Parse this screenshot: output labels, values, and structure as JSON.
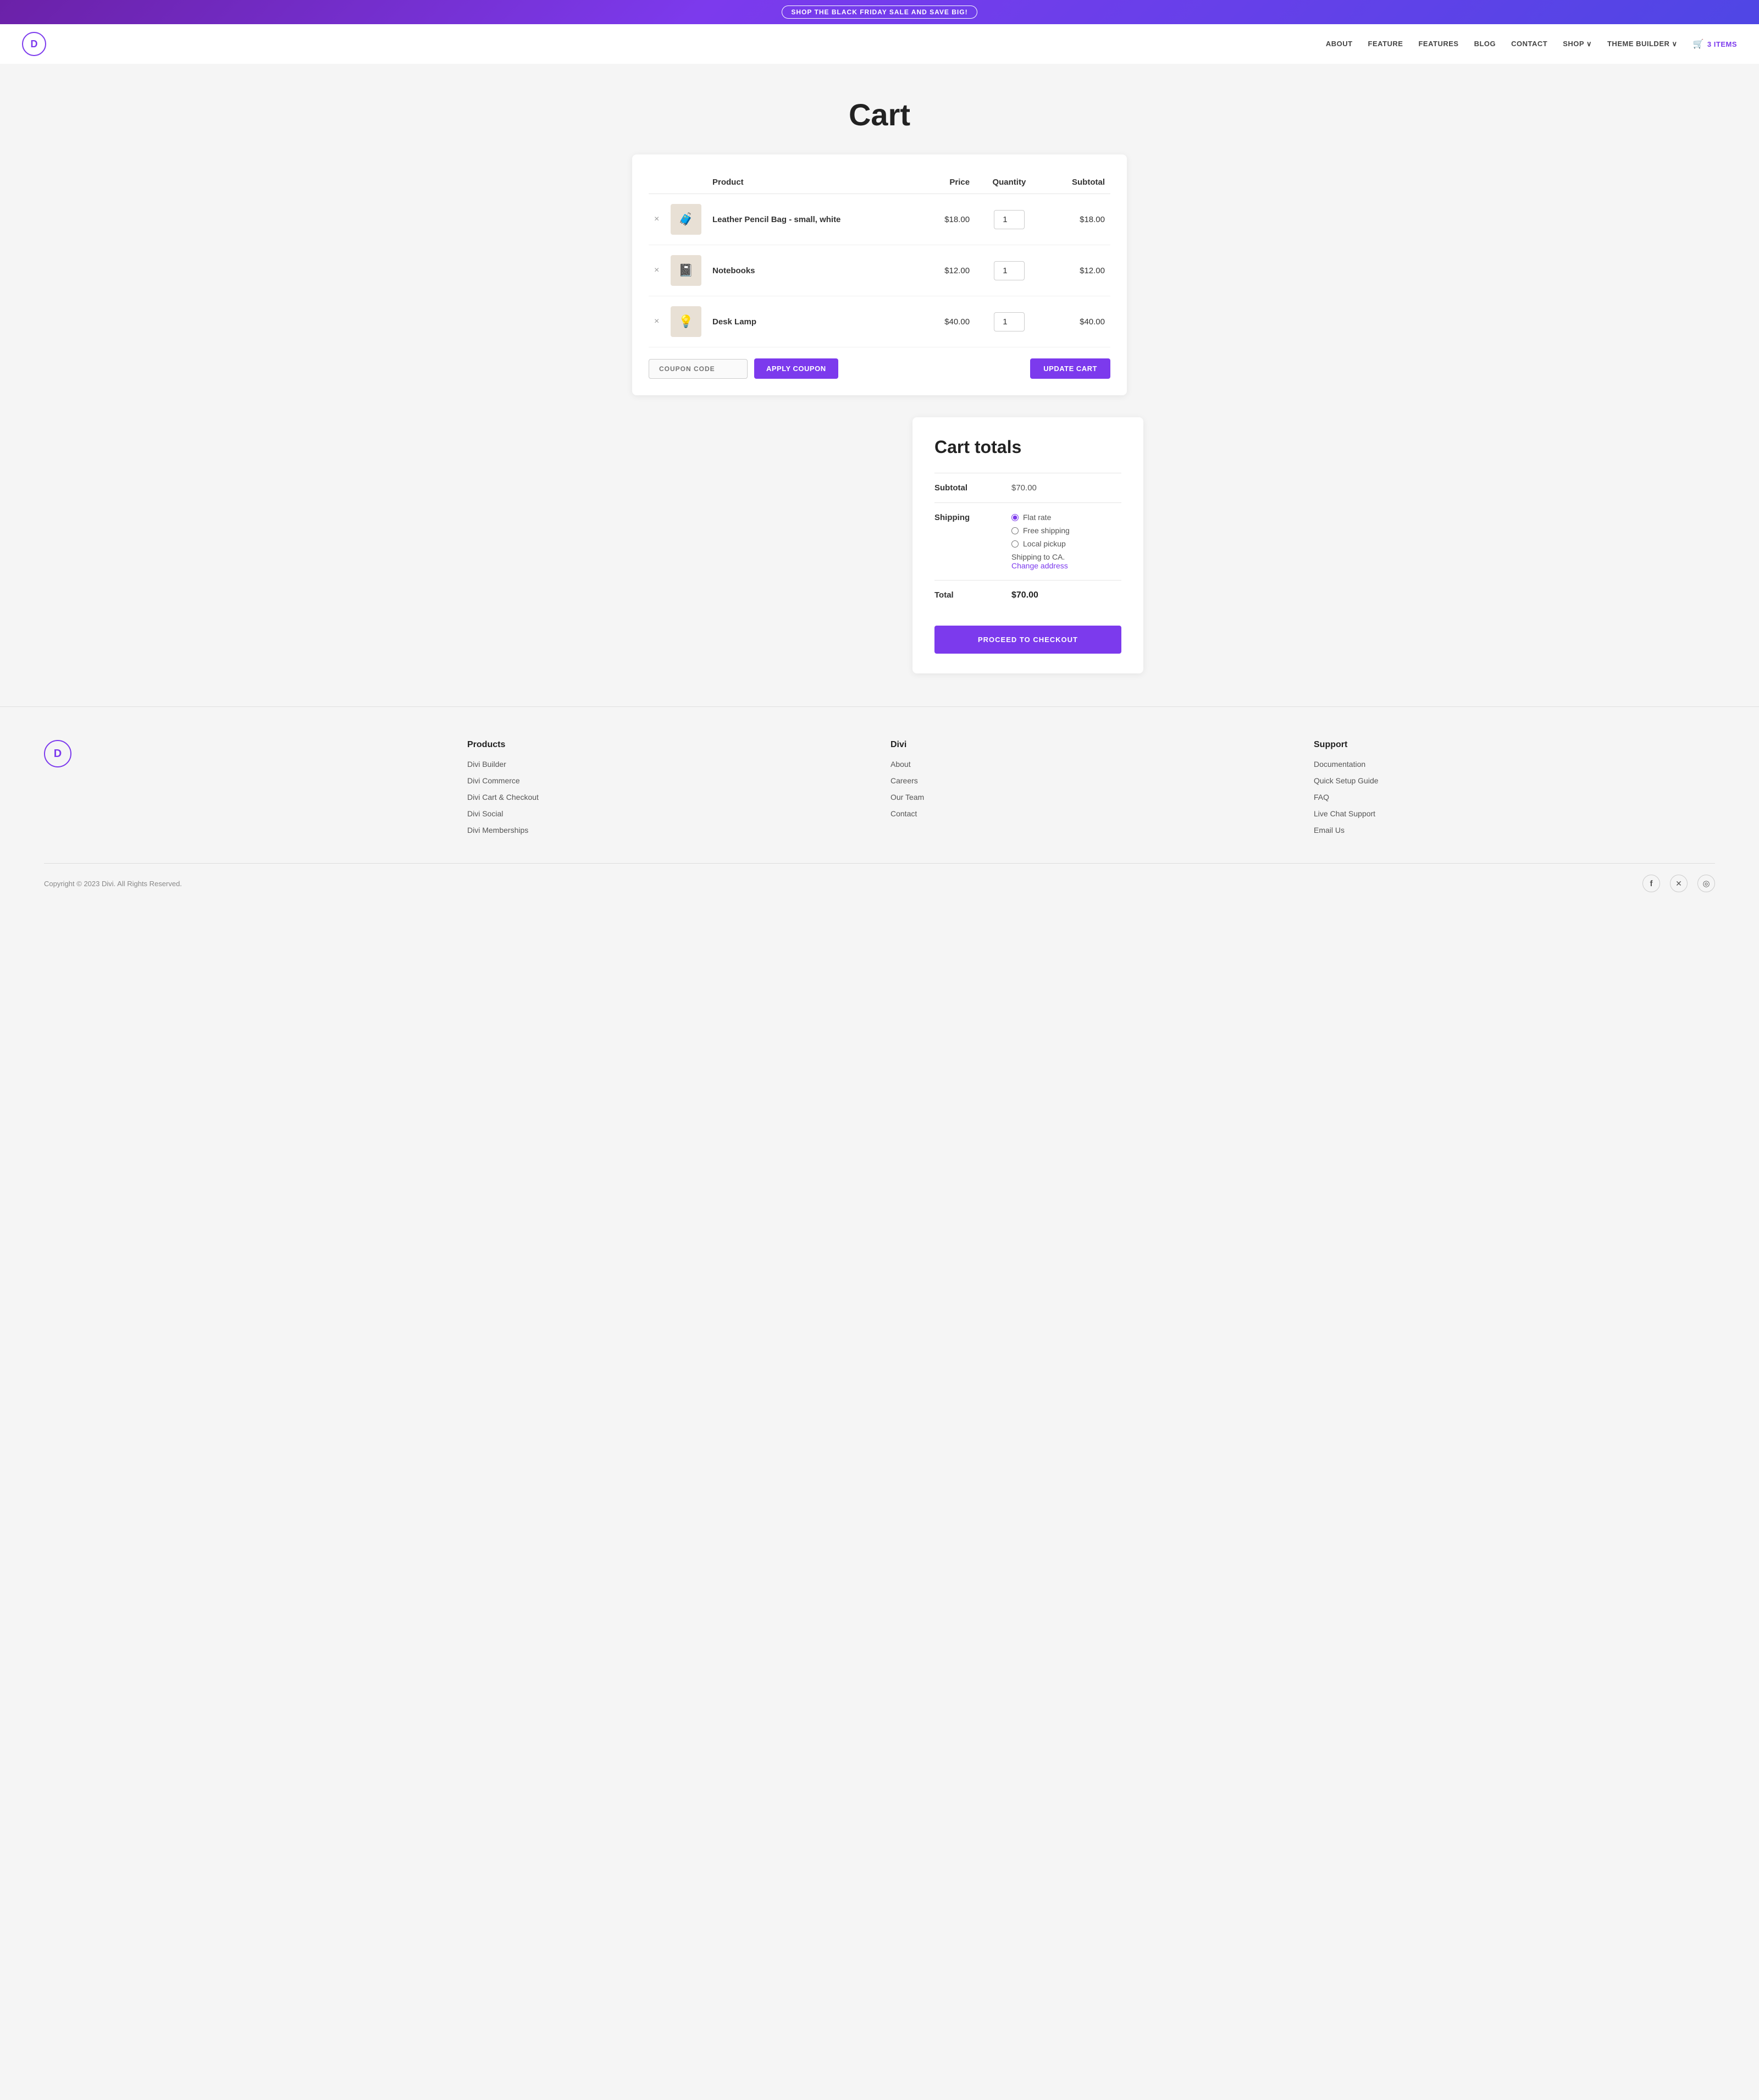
{
  "banner": {
    "text": "SHOP THE BLACK FRIDAY SALE AND SAVE BIG!"
  },
  "nav": {
    "logo_letter": "D",
    "links": [
      "ABOUT",
      "FEATURE",
      "FEATURES",
      "BLOG",
      "CONTACT",
      "SHOP ∨",
      "THEME BUILDER ∨"
    ],
    "cart_label": "3 ITEMS"
  },
  "page": {
    "title": "Cart"
  },
  "cart_table": {
    "headers": {
      "product": "Product",
      "price": "Price",
      "quantity": "Quantity",
      "subtotal": "Subtotal"
    },
    "items": [
      {
        "id": 1,
        "name": "Leather Pencil Bag - small, white",
        "price": "$18.00",
        "quantity": 1,
        "subtotal": "$18.00",
        "icon": "🧳"
      },
      {
        "id": 2,
        "name": "Notebooks",
        "price": "$12.00",
        "quantity": 1,
        "subtotal": "$12.00",
        "icon": "📓"
      },
      {
        "id": 3,
        "name": "Desk Lamp",
        "price": "$40.00",
        "quantity": 1,
        "subtotal": "$40.00",
        "icon": "💡"
      }
    ],
    "coupon_placeholder": "COUPON CODE",
    "apply_coupon_label": "APPLY COUPON",
    "update_cart_label": "UPDATE CART"
  },
  "cart_totals": {
    "title": "Cart totals",
    "subtotal_label": "Subtotal",
    "subtotal_value": "$70.00",
    "shipping_label": "Shipping",
    "shipping_options": [
      {
        "id": "flat",
        "label": "Flat rate",
        "checked": true
      },
      {
        "id": "free",
        "label": "Free shipping",
        "checked": false
      },
      {
        "id": "local",
        "label": "Local pickup",
        "checked": false
      }
    ],
    "shipping_to": "Shipping to CA.",
    "change_address": "Change address",
    "total_label": "Total",
    "total_value": "$70.00",
    "proceed_label": "PROCEED TO CHECKOUT"
  },
  "footer": {
    "logo_letter": "D",
    "columns": [
      {
        "title": "Products",
        "links": [
          "Divi Builder",
          "Divi Commerce",
          "Divi Cart & Checkout",
          "Divi Social",
          "Divi Memberships"
        ]
      },
      {
        "title": "Divi",
        "links": [
          "About",
          "Careers",
          "Our Team",
          "Contact"
        ]
      },
      {
        "title": "Support",
        "links": [
          "Documentation",
          "Quick Setup Guide",
          "FAQ",
          "Live Chat Support",
          "Email Us"
        ]
      }
    ],
    "copyright": "Copyright © 2023 Divi. All Rights Reserved.",
    "social": [
      {
        "name": "facebook",
        "icon": "f"
      },
      {
        "name": "twitter-x",
        "icon": "𝕏"
      },
      {
        "name": "instagram",
        "icon": "⬡"
      }
    ]
  }
}
